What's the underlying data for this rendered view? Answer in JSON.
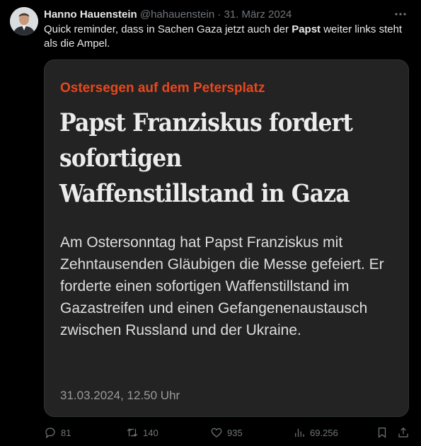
{
  "tweet": {
    "author_name": "Hanno Hauenstein",
    "handle": "@hahauenstein",
    "separator": "·",
    "date": "31. März 2024",
    "text_before": "Quick reminder, dass in Sachen Gaza jetzt auch der ",
    "text_bold": "Papst",
    "text_after": " weiter links steht als die Ampel."
  },
  "card": {
    "kicker": "Ostersegen auf dem Petersplatz",
    "headline": "Papst Franziskus fordert sofortigen Waffenstillstand in Gaza",
    "teaser": "Am Ostersonntag hat Papst Franziskus mit Zehntausenden Gläubigen die Messe gefeiert. Er forderte einen sofortigen Waffenstillstand im Gazastreifen und einen Gefangenenaustausch zwischen Russland und der Ukraine.",
    "dateline": "31.03.2024, 12.50 Uhr",
    "kicker_color": "#e8471d"
  },
  "actions": {
    "replies": "81",
    "retweets": "140",
    "likes": "935",
    "views": "69.256",
    "icons": [
      "reply-icon",
      "retweet-icon",
      "like-icon",
      "views-icon",
      "bookmark-icon",
      "share-icon"
    ]
  }
}
